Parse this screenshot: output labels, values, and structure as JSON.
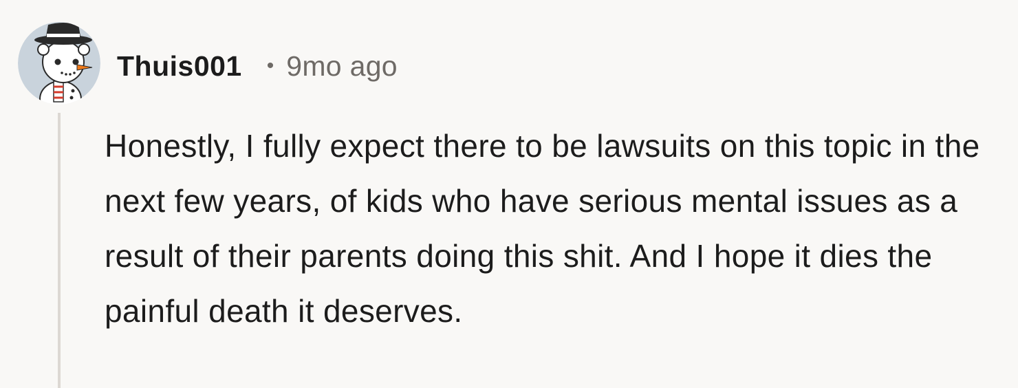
{
  "comment": {
    "author": "Thuis001",
    "separator": "•",
    "timestamp": "9mo ago",
    "avatar_icon": "snowman-avatar-icon",
    "body": "Honestly, I fully expect there to be lawsuits on this topic in the next few years, of kids who have serious mental issues as a result of their parents doing this shit. And I hope it dies the painful death it deserves."
  },
  "colors": {
    "background": "#f9f8f6",
    "text": "#1c1c1c",
    "muted": "#6e6a66",
    "thread_line": "#dcd8d3",
    "avatar_bg": "#c9d3dc"
  }
}
